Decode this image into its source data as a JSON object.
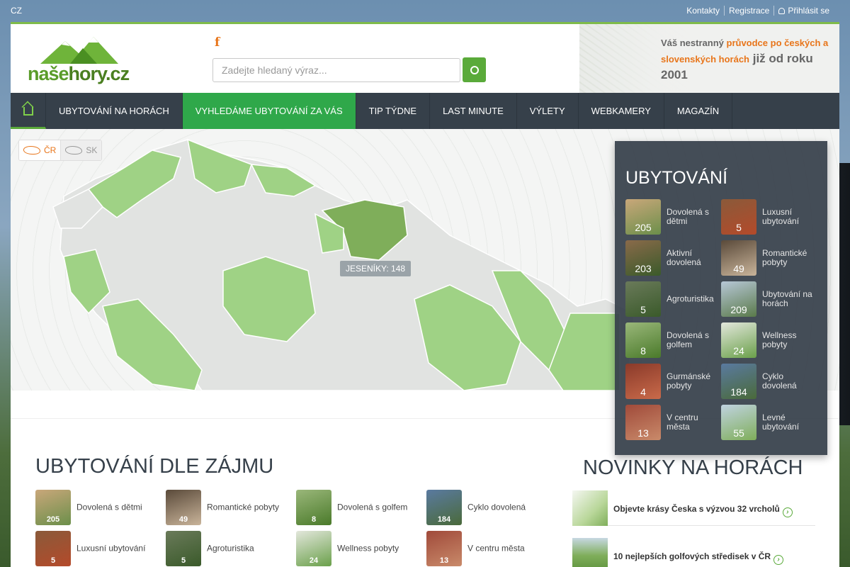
{
  "topbar": {
    "lang": "CZ",
    "contacts": "Kontakty",
    "register": "Registrace",
    "login": "Přihlásit se"
  },
  "header": {
    "logo_text_a": "naše",
    "logo_text_b": "hory.cz",
    "search_placeholder": "Zadejte hledaný výraz...",
    "slogan_a": "Váš nestranný ",
    "slogan_b": "průvodce po českých a slovenských horách",
    "slogan_c": " již od roku 2001"
  },
  "nav": [
    {
      "label": "UBYTOVÁNÍ NA HORÁCH"
    },
    {
      "label": "VYHLEDÁME UBYTOVÁNÍ ZA VÁS"
    },
    {
      "label": "TIP TÝDNE"
    },
    {
      "label": "LAST MINUTE"
    },
    {
      "label": "VÝLETY"
    },
    {
      "label": "WEBKAMERY"
    },
    {
      "label": "MAGAZÍN"
    }
  ],
  "map": {
    "cz_label": "ČR",
    "sk_label": "SK",
    "tooltip": "JESENÍKY: 148",
    "colors": {
      "active_region": "#7fae5a",
      "region": "#9fd285",
      "inactive": "#e1e3e1"
    }
  },
  "panel": {
    "title": "UBYTOVÁNÍ",
    "items": [
      {
        "label": "Dovolená s dětmi",
        "count": "205"
      },
      {
        "label": "Luxusní ubytování",
        "count": "5"
      },
      {
        "label": "Aktivní dovolená",
        "count": "203"
      },
      {
        "label": "Romantické pobyty",
        "count": "49"
      },
      {
        "label": "Agroturistika",
        "count": "5"
      },
      {
        "label": "Ubytování na horách",
        "count": "209"
      },
      {
        "label": "Dovolená s golfem",
        "count": "8"
      },
      {
        "label": "Wellness pobyty",
        "count": "24"
      },
      {
        "label": "Gurmánské pobyty",
        "count": "4"
      },
      {
        "label": "Cyklo dovolená",
        "count": "184"
      },
      {
        "label": "V centru města",
        "count": "13"
      },
      {
        "label": "Levné ubytování",
        "count": "55"
      }
    ]
  },
  "interest": {
    "title": "UBYTOVÁNÍ DLE ZÁJMU",
    "items": [
      {
        "label": "Dovolená s dětmi",
        "count": "205"
      },
      {
        "label": "Romantické pobyty",
        "count": "49"
      },
      {
        "label": "Dovolená s golfem",
        "count": "8"
      },
      {
        "label": "Cyklo dovolená",
        "count": "184"
      },
      {
        "label": "Luxusní ubytování",
        "count": "5"
      },
      {
        "label": "Agroturistika",
        "count": "5"
      },
      {
        "label": "Wellness pobyty",
        "count": "24"
      },
      {
        "label": "V centru města",
        "count": "13"
      }
    ]
  },
  "news": {
    "title": "NOVINKY NA HORÁCH",
    "items": [
      {
        "label": "Objevte krásy Česka s výzvou 32 vrcholů"
      },
      {
        "label": "10 nejlepších golfových středisek v ČR"
      }
    ]
  }
}
